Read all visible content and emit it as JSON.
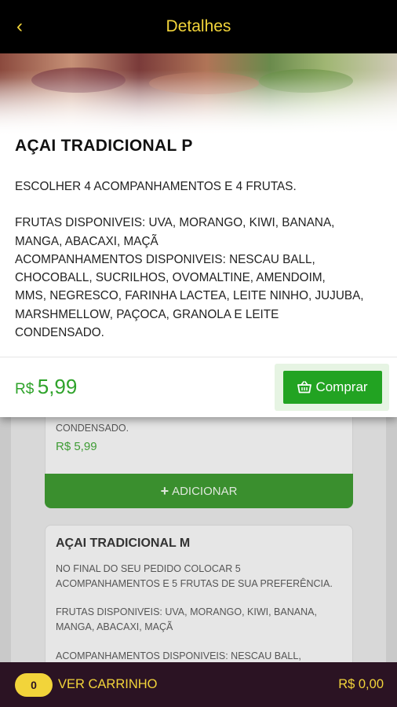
{
  "header": {
    "back_icon": "chevron-left-icon",
    "title": "Detalhes"
  },
  "product": {
    "name": "AÇAI TRADICIONAL P",
    "description_lines": [
      "ESCOLHER 4 ACOMPANHAMENTOS E 4 FRUTAS.",
      "",
      "FRUTAS DISPONIVEIS: UVA, MORANGO, KIWI, BANANA,",
      "MANGA, ABACAXI, MAÇÃ",
      "ACOMPANHAMENTOS DISPONIVEIS: NESCAU BALL,",
      "CHOCOBALL, SUCRILHOS, OVOMALTINE, AMENDOIM,",
      "MMS, NEGRESCO, FARINHA LACTEA, LEITE NINHO, JUJUBA,",
      "MARSHMELLOW, PAÇOCA, GRANOLA E LEITE",
      "CONDENSADO."
    ],
    "currency": "R$",
    "price": "5,99",
    "buy_label": "Comprar",
    "buy_icon": "basket-icon"
  },
  "background_list": {
    "first_card_tail": "CONDENSADO.",
    "first_card_price": "R$ 5,99",
    "add_label": "ADICIONAR",
    "second_card": {
      "title": "AÇAI TRADICIONAL M",
      "lines": [
        "NO FINAL DO SEU PEDIDO COLOCAR 5",
        "ACOMPANHAMENTOS E 5 FRUTAS DE SUA PREFERÊNCIA.",
        "FRUTAS DISPONIVEIS: UVA, MORANGO, KIWI, BANANA,",
        "MANGA, ABACAXI, MAÇÃ",
        "ACOMPANHAMENTOS DISPONIVEIS: NESCAU BALL,"
      ]
    }
  },
  "cart": {
    "count": "0",
    "label": "VER CARRINHO",
    "total": "R$ 0,00"
  },
  "colors": {
    "header_bg": "#000000",
    "accent_yellow": "#f2d43a",
    "green": "#22a322",
    "cart_bg": "#2b1323"
  }
}
